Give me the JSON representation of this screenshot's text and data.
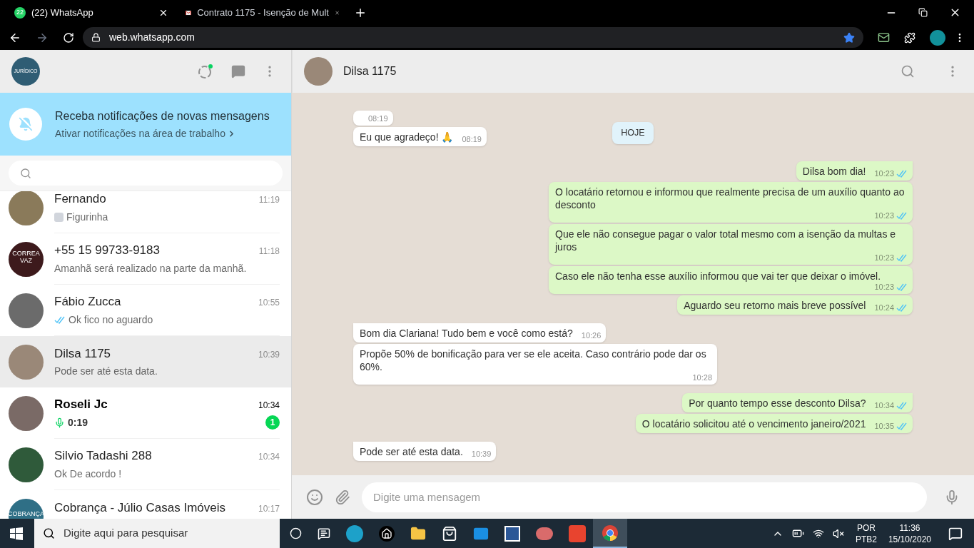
{
  "browser": {
    "tabs": [
      {
        "title": "(22) WhatsApp",
        "favicon": {
          "kind": "whatsapp",
          "badge": "22"
        },
        "selected": true
      },
      {
        "title": "Contrato 1175 - Isenção de Mult",
        "favicon": {
          "kind": "gmail"
        },
        "selected": false
      }
    ],
    "url": "web.whatsapp.com"
  },
  "sidebar": {
    "profile": {
      "logo_text": "JURÍDICO"
    },
    "banner": {
      "title": "Receba notificações de novas mensagens",
      "subtitle": "Ativar notificações na área de trabalho"
    },
    "chats": [
      {
        "name": "Fernando",
        "time": "11:19",
        "preview": {
          "kind": "sticker",
          "text": "Figurinha"
        },
        "color": "#8a7a5a",
        "unread": false,
        "selected": false
      },
      {
        "name": "+55 15 99733-9183",
        "time": "11:18",
        "preview": {
          "kind": "text",
          "text": "Amanhã será realizado na parte da manhã."
        },
        "color": "#3d1a1c",
        "logo_text": "CORREA VAZ",
        "unread": false,
        "selected": false
      },
      {
        "name": "Fábio Zucca",
        "time": "10:55",
        "preview": {
          "kind": "read",
          "text": "Ok fico no aguardo"
        },
        "color": "#6b6b6b",
        "unread": false,
        "selected": false
      },
      {
        "name": "Dilsa 1175",
        "time": "10:39",
        "preview": {
          "kind": "text",
          "text": "Pode ser até esta data."
        },
        "color": "#9a8878",
        "unread": false,
        "selected": true
      },
      {
        "name": "Roseli Jc",
        "time": "10:34",
        "preview": {
          "kind": "audio",
          "text": "0:19"
        },
        "color": "#7a6a66",
        "unread": true,
        "unread_count": "1",
        "selected": false
      },
      {
        "name": "Silvio Tadashi 288",
        "time": "10:34",
        "preview": {
          "kind": "text",
          "text": "Ok De acordo !"
        },
        "color": "#2f5a3a",
        "unread": false,
        "selected": false
      },
      {
        "name": "Cobrança - Júlio Casas Imóveis",
        "time": "10:17",
        "color": "#2f6f86",
        "logo_text": "COBRANÇA",
        "unread": false,
        "selected": false
      }
    ]
  },
  "chat": {
    "contact": "Dilsa 1175",
    "messages": [
      {
        "kind": "incoming",
        "time": "08:19",
        "group_start": false
      },
      {
        "kind": "incoming",
        "text": "Eu que agradeço! 🙏",
        "time": "08:19",
        "group_start": false
      },
      {
        "kind": "date",
        "text": "HOJE"
      },
      {
        "kind": "outgoing",
        "text": "Dilsa bom dia!",
        "time": "10:23",
        "read": true,
        "group_start": true
      },
      {
        "kind": "outgoing",
        "text": "O locatário retornou e informou que realmente precisa de um auxílio quanto ao desconto",
        "time": "10:23",
        "read": true,
        "group_start": false
      },
      {
        "kind": "outgoing",
        "text": "Que ele não consegue pagar o valor total mesmo com a isenção da multas e juros",
        "time": "10:23",
        "read": true,
        "group_start": false
      },
      {
        "kind": "outgoing",
        "text": "Caso ele não tenha esse auxílio informou que vai ter que deixar o imóvel.",
        "time": "10:23",
        "read": true,
        "group_start": false
      },
      {
        "kind": "outgoing",
        "text": "Aguardo seu retorno mais breve possível",
        "time": "10:24",
        "read": true,
        "group_start": false
      },
      {
        "kind": "incoming",
        "text": "Bom dia Clariana! Tudo bem e você como está?",
        "time": "10:26",
        "group_start": true
      },
      {
        "kind": "incoming",
        "text": "Propõe 50% de bonificação para ver se ele aceita. Caso contrário pode dar os 60%.",
        "time": "10:28",
        "group_start": false
      },
      {
        "kind": "outgoing",
        "text": "Por quanto tempo esse desconto Dilsa?",
        "time": "10:34",
        "read": true,
        "group_start": true
      },
      {
        "kind": "outgoing",
        "text": "O locatário solicitou até o vencimento janeiro/2021",
        "time": "10:35",
        "read": true,
        "group_start": false
      },
      {
        "kind": "incoming",
        "text": "Pode ser até esta data.",
        "time": "10:39",
        "group_start": true
      }
    ],
    "composer": {
      "placeholder": "Digite uma mensagem"
    }
  },
  "taskbar": {
    "search_placeholder": "Digite aqui para pesquisar",
    "language": "POR",
    "layout": "PTB2",
    "time": "11:36",
    "date": "15/10/2020"
  }
}
